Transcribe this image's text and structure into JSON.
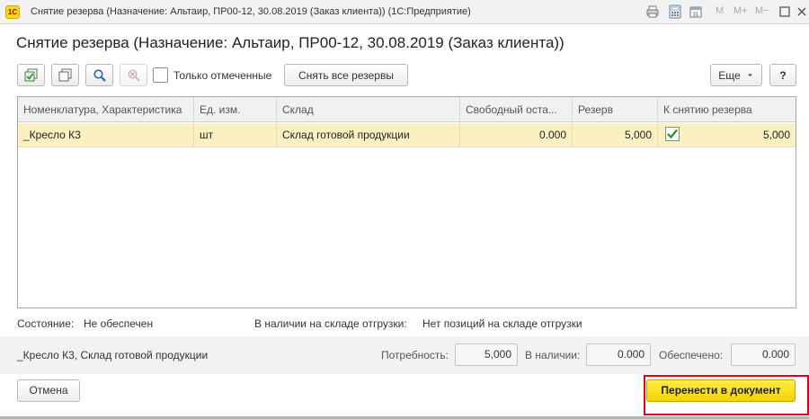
{
  "window": {
    "app_logo": "1С",
    "title": "Снятие резерва (Назначение: Альтаир, ПР00-12, 30.08.2019 (Заказ клиента))  (1С:Предприятие)",
    "controls": {
      "m": "M",
      "m_plus": "M+",
      "m_minus": "M−"
    }
  },
  "form": {
    "title": "Снятие резерва (Назначение: Альтаир, ПР00-12, 30.08.2019 (Заказ клиента))"
  },
  "toolbar": {
    "only_marked_label": "Только отмеченные",
    "only_marked_checked": false,
    "remove_all_label": "Снять все резервы",
    "more_label": "Еще",
    "help_label": "?"
  },
  "table": {
    "columns": [
      "Номенклатура, Характеристика",
      "Ед. изм.",
      "Склад",
      "Свободный оста...",
      "Резерв",
      "К снятию резерва"
    ],
    "rows": [
      {
        "item": "_Кресло К3",
        "unit": "шт",
        "warehouse": "Склад готовой продукции",
        "free": "0.000",
        "reserve": "5,000",
        "checked": true,
        "to_remove": "5,000"
      }
    ]
  },
  "status": {
    "state_label": "Состояние:",
    "state_value": "Не обеспечен",
    "stock_label": "В наличии на складе отгрузки:",
    "stock_value": "Нет позиций на складе отгрузки"
  },
  "info": {
    "item_desc": "_Кресло К3, Склад готовой продукции",
    "need_label": "Потребность:",
    "need_value": "5,000",
    "available_label": "В наличии:",
    "available_value": "0.000",
    "provided_label": "Обеспечено:",
    "provided_value": "0.000"
  },
  "footer": {
    "cancel_label": "Отмена",
    "transfer_label": "Перенести в документ"
  },
  "colors": {
    "selected_row": "#fbf0c2",
    "primary_button": "#f5d300",
    "highlight_frame": "#e3001b",
    "checkmark": "#2e8b2e"
  }
}
